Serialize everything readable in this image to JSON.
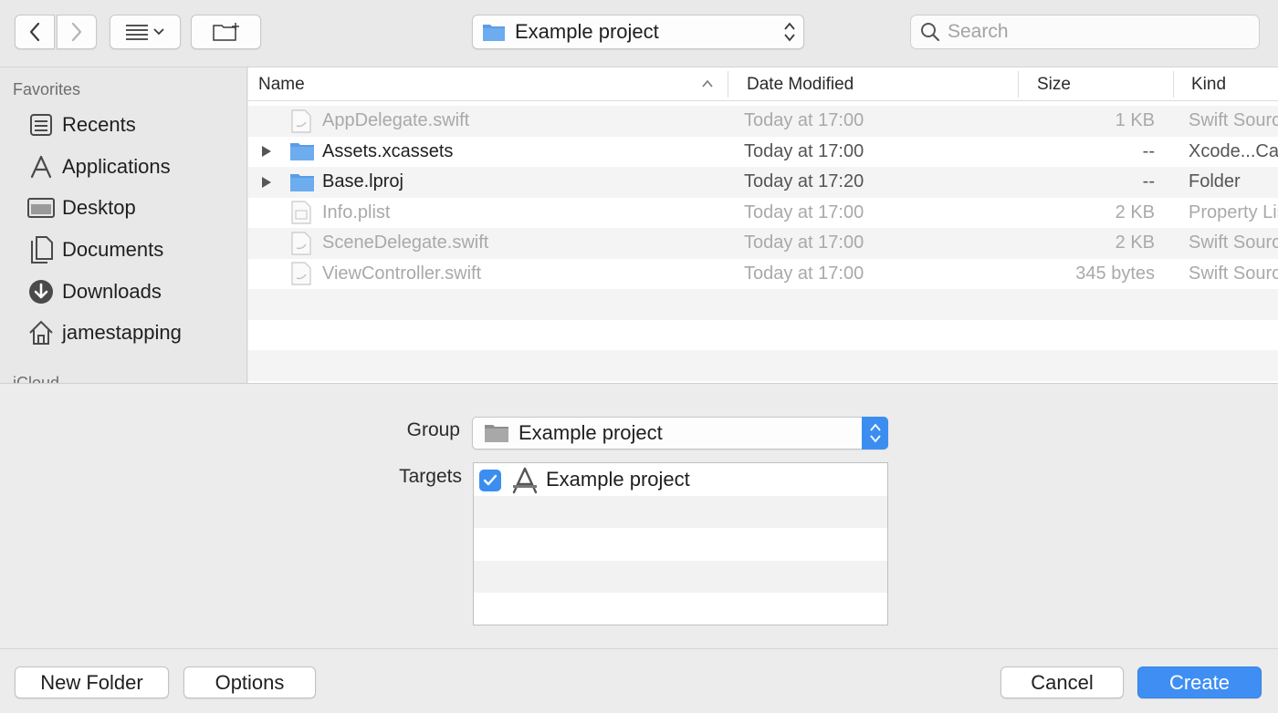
{
  "toolbar": {
    "path_label": "Example project",
    "search_placeholder": "Search"
  },
  "sidebar": {
    "favorites_header": "Favorites",
    "items": [
      {
        "label": "Recents",
        "icon": "recents-icon"
      },
      {
        "label": "Applications",
        "icon": "applications-icon"
      },
      {
        "label": "Desktop",
        "icon": "desktop-icon"
      },
      {
        "label": "Documents",
        "icon": "documents-icon"
      },
      {
        "label": "Downloads",
        "icon": "downloads-icon"
      },
      {
        "label": "jamestapping",
        "icon": "home-icon"
      }
    ],
    "next_header_partial": "iCloud"
  },
  "filelist": {
    "columns": {
      "name": "Name",
      "date": "Date Modified",
      "size": "Size",
      "kind": "Kind"
    },
    "sort": "name-ascending",
    "rows": [
      {
        "name": "AppDelegate.swift",
        "date": "Today at 17:00",
        "size": "1 KB",
        "kind": "Swift Source",
        "type": "swift",
        "enabled": false
      },
      {
        "name": "Assets.xcassets",
        "date": "Today at 17:00",
        "size": "--",
        "kind": "Xcode...Catalog",
        "type": "folder",
        "enabled": true
      },
      {
        "name": "Base.lproj",
        "date": "Today at 17:20",
        "size": "--",
        "kind": "Folder",
        "type": "folder",
        "enabled": true
      },
      {
        "name": "Info.plist",
        "date": "Today at 17:00",
        "size": "2 KB",
        "kind": "Property List",
        "type": "plist",
        "enabled": false
      },
      {
        "name": "SceneDelegate.swift",
        "date": "Today at 17:00",
        "size": "2 KB",
        "kind": "Swift Source",
        "type": "swift",
        "enabled": false
      },
      {
        "name": "ViewController.swift",
        "date": "Today at 17:00",
        "size": "345 bytes",
        "kind": "Swift Source",
        "type": "swift",
        "enabled": false
      }
    ]
  },
  "options": {
    "group_label": "Group",
    "group_value": "Example project",
    "targets_label": "Targets",
    "targets": [
      {
        "name": "Example project",
        "checked": true
      }
    ]
  },
  "buttons": {
    "new_folder": "New Folder",
    "options": "Options",
    "cancel": "Cancel",
    "create": "Create"
  },
  "colors": {
    "accent": "#3b8ef0",
    "folder": "#5a9de6"
  }
}
